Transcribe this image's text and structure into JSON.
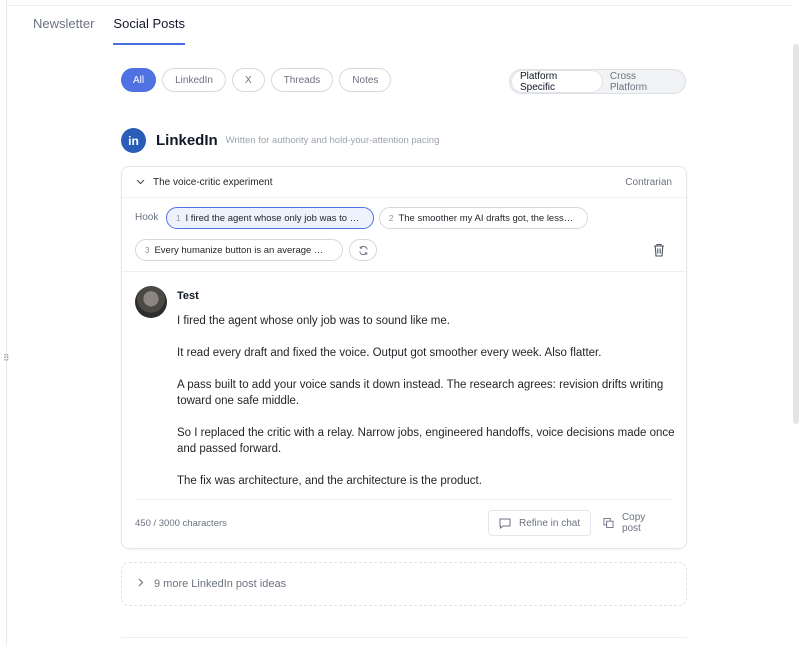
{
  "page_tabs": [
    {
      "label": "Newsletter",
      "active": false
    },
    {
      "label": "Social Posts",
      "active": true
    }
  ],
  "filters": [
    "All",
    "LinkedIn",
    "X",
    "Threads",
    "Notes"
  ],
  "view_toggle": [
    "Platform Specific",
    "Cross Platform"
  ],
  "platform": {
    "name": "LinkedIn",
    "logo_text": "in",
    "description": "Written for authority and hold-your-attention pacing"
  },
  "card": {
    "title": "The voice-critic experiment",
    "tag": "Contrarian",
    "hook_label": "Hook",
    "hooks": [
      {
        "num": "1",
        "text": "I fired the agent whose only job was to …"
      },
      {
        "num": "2",
        "text": "The smoother my AI drafts got, the less…"
      },
      {
        "num": "3",
        "text": "Every humanize button is an average …"
      }
    ],
    "author": "Test",
    "body": [
      "I fired the agent whose only job was to sound like me.",
      "It read every draft and fixed the voice. Output got smoother every week. Also flatter.",
      "A pass built to add your voice sands it down instead. The research agrees: revision drifts writing toward one safe middle.",
      "So I replaced the critic with a relay. Narrow jobs, engineered handoffs, voice decisions made once and passed forward.",
      "The fix was architecture, and the architecture is the product."
    ],
    "char_count": "450 / 3000 characters",
    "refine_label": "Refine in chat",
    "copy_label": "Copy post"
  },
  "more_ideas_label": "9 more LinkedIn post ideas",
  "colors": {
    "accent": "#4f72e3",
    "linkedin": "#2a5db8"
  }
}
